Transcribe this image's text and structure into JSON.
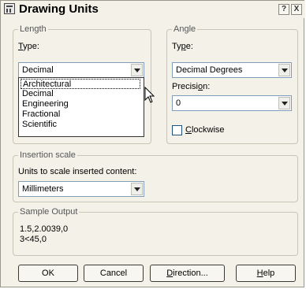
{
  "window": {
    "title": "Drawing Units",
    "help_glyph": "?",
    "close_glyph": "X"
  },
  "length": {
    "legend": "Length",
    "type_label": "Type:",
    "type_value": "Decimal",
    "list_options": [
      "Architectural",
      "Decimal",
      "Engineering",
      "Fractional",
      "Scientific"
    ],
    "highlighted_option": "Architectural"
  },
  "angle": {
    "legend": "Angle",
    "type_label": "Type:",
    "type_value": "Decimal Degrees",
    "precision_label": "Precision:",
    "precision_value": "0",
    "clockwise_label": "Clockwise",
    "clockwise_checked": false
  },
  "insertion": {
    "legend": "Insertion scale",
    "units_label": "Units to scale inserted content:",
    "units_value": "Millimeters"
  },
  "sample": {
    "legend": "Sample Output",
    "line1": "1.5,2.0039,0",
    "line2": "3<45,0"
  },
  "buttons": {
    "ok": "OK",
    "cancel": "Cancel",
    "direction": "Direction...",
    "help": "Help"
  }
}
